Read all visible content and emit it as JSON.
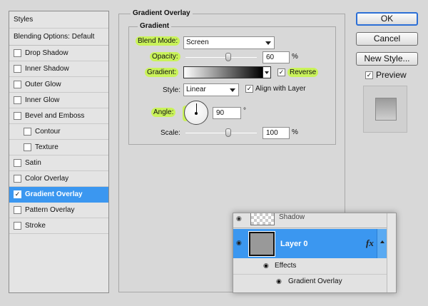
{
  "styles_panel": {
    "header": "Styles",
    "blending_options": "Blending Options: Default",
    "items": [
      {
        "label": "Drop Shadow",
        "checked": false
      },
      {
        "label": "Inner Shadow",
        "checked": false
      },
      {
        "label": "Outer Glow",
        "checked": false
      },
      {
        "label": "Inner Glow",
        "checked": false
      },
      {
        "label": "Bevel and Emboss",
        "checked": false
      },
      {
        "label": "Contour",
        "checked": false,
        "sub": true
      },
      {
        "label": "Texture",
        "checked": false,
        "sub": true
      },
      {
        "label": "Satin",
        "checked": false
      },
      {
        "label": "Color Overlay",
        "checked": false
      },
      {
        "label": "Gradient Overlay",
        "checked": true,
        "active": true
      },
      {
        "label": "Pattern Overlay",
        "checked": false
      },
      {
        "label": "Stroke",
        "checked": false
      }
    ]
  },
  "gradient_overlay": {
    "group_title": "Gradient Overlay",
    "inner_title": "Gradient",
    "blend_mode_label": "Blend Mode:",
    "blend_mode_value": "Screen",
    "opacity_label": "Opacity:",
    "opacity_value": "60",
    "opacity_unit": "%",
    "opacity_fraction": 0.6,
    "gradient_label": "Gradient:",
    "reverse_label": "Reverse",
    "reverse_checked": true,
    "style_label": "Style:",
    "style_value": "Linear",
    "align_label": "Align with Layer",
    "align_checked": true,
    "angle_label": "Angle:",
    "angle_value": "90",
    "angle_unit": "°",
    "scale_label": "Scale:",
    "scale_value": "100",
    "scale_unit": "%",
    "scale_fraction": 0.6
  },
  "buttons": {
    "ok": "OK",
    "cancel": "Cancel",
    "new_style": "New Style...",
    "preview": "Preview",
    "preview_checked": true
  },
  "layers_inset": {
    "shadow_label": "Shadow",
    "layer_name": "Layer 0",
    "fx": "fx",
    "effects_label": "Effects",
    "effect_item": "Gradient Overlay"
  },
  "colors": {
    "highlight": "#c9f25a",
    "selection": "#3b97f0",
    "primary_button_border": "#2c6fd6"
  }
}
